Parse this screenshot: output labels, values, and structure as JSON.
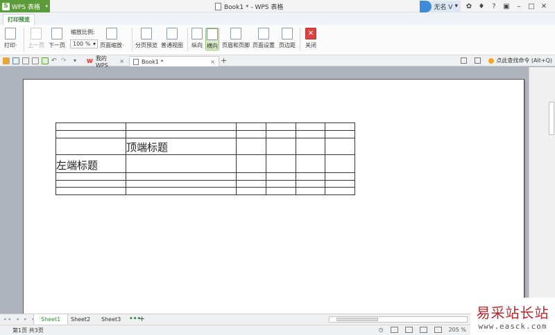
{
  "titlebar": {
    "app_name": "WPS 表格",
    "app_logo": "S",
    "doc_title": "Book1 * - WPS 表格",
    "user_name": "无名 V",
    "help": "?"
  },
  "ribbon_tab": {
    "label": "打印预览"
  },
  "ribbon": {
    "print": "打印·",
    "prev_page": "上一页",
    "next_page": "下一页",
    "zoom_label": "缩放比例:",
    "zoom_value": "100 %",
    "page_zoom": "页面缩放·",
    "page_preview": "分页预览",
    "normal_view": "普通视图",
    "portrait": "纵向",
    "landscape": "横向",
    "header_footer": "页眉和页脚",
    "page_setup": "页面设置",
    "margins": "页边距",
    "close": "关闭"
  },
  "doc_tabs": {
    "wps_tab": "我的WPS",
    "book_tab": "Book1 *",
    "search_command": "点此查找命令 (Alt+Q)"
  },
  "sheet": {
    "top_title": "顶端标题",
    "left_title": "左端标题"
  },
  "sheet_tabs": [
    "Sheet1",
    "Sheet2",
    "Sheet3"
  ],
  "status": {
    "page_info": "第1页 共3页",
    "zoom": "205 %"
  },
  "watermark": {
    "line1": "易采站长站",
    "line2": "www.easck.com"
  },
  "colors": {
    "brand_green": "#5b9c3a",
    "active_tab_green": "#2e8b3a",
    "close_red": "#d64541"
  }
}
